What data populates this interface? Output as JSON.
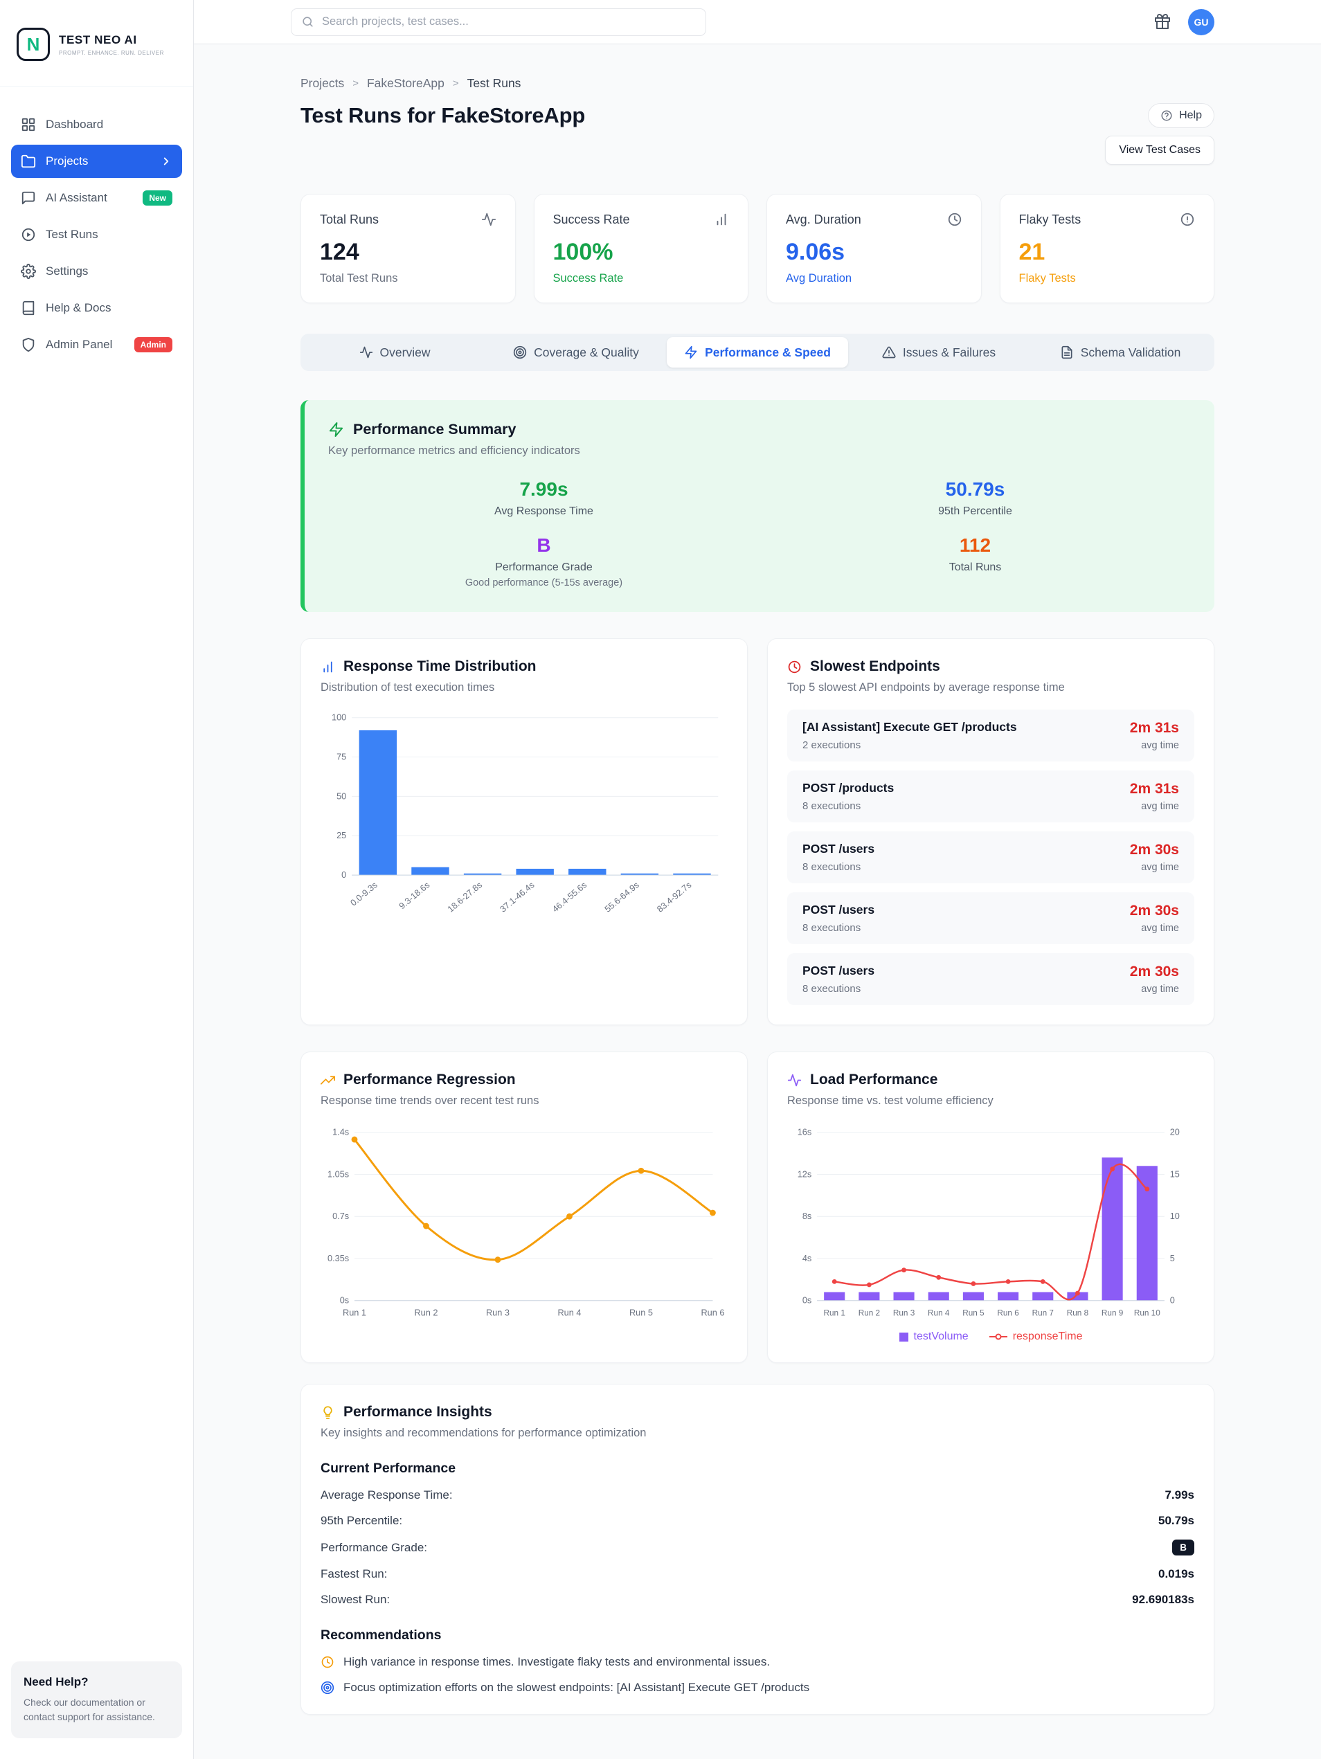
{
  "colors": {
    "accent": "#2563eb",
    "success_green": "#16a34a",
    "info_blue": "#2563eb",
    "grade_purple": "#9333ea",
    "warn_orange": "#ea580c",
    "flaky_amber": "#f59e0b",
    "slow_red": "#dc2626",
    "bar_blue": "#3b82f6",
    "volume_violet": "#8b5cf6"
  },
  "sidebar": {
    "logo": {
      "letter": "N",
      "title": "TEST NEO AI",
      "subtitle": "PROMPT. ENHANCE. RUN. DELIVER"
    },
    "items": [
      {
        "label": "Dashboard",
        "icon": "grid-icon"
      },
      {
        "label": "Projects",
        "icon": "folder-icon",
        "active": true
      },
      {
        "label": "AI Assistant",
        "icon": "chat-icon",
        "badge": "New"
      },
      {
        "label": "Test Runs",
        "icon": "play-circle-icon"
      },
      {
        "label": "Settings",
        "icon": "gear-icon"
      },
      {
        "label": "Help & Docs",
        "icon": "book-icon"
      },
      {
        "label": "Admin Panel",
        "icon": "shield-icon",
        "badge": "Admin"
      }
    ],
    "help_card": {
      "title": "Need Help?",
      "text": "Check our documentation or contact support for assistance."
    }
  },
  "topbar": {
    "search_placeholder": "Search projects, test cases...",
    "avatar_initials": "GU"
  },
  "breadcrumb": {
    "items": [
      "Projects",
      "FakeStoreApp",
      "Test Runs"
    ],
    "separator": ">"
  },
  "page": {
    "title": "Test Runs for FakeStoreApp",
    "help_button": "Help",
    "view_test_cases_button": "View Test Cases"
  },
  "stats": [
    {
      "label": "Total Runs",
      "value": "124",
      "sub": "Total Test Runs",
      "icon": "activity-icon",
      "value_color": "#111827",
      "sub_color": "#6b7280"
    },
    {
      "label": "Success Rate",
      "value": "100%",
      "sub": "Success Rate",
      "icon": "bar-chart-icon",
      "value_color": "#16a34a",
      "sub_color": "#16a34a"
    },
    {
      "label": "Avg. Duration",
      "value": "9.06s",
      "sub": "Avg Duration",
      "icon": "clock-icon",
      "value_color": "#2563eb",
      "sub_color": "#2563eb"
    },
    {
      "label": "Flaky Tests",
      "value": "21",
      "sub": "Flaky Tests",
      "icon": "alert-circle-icon",
      "value_color": "#f59e0b",
      "sub_color": "#f59e0b"
    }
  ],
  "tabs": [
    {
      "label": "Overview",
      "icon": "pulse-icon",
      "active": false
    },
    {
      "label": "Coverage & Quality",
      "icon": "target-icon",
      "active": false
    },
    {
      "label": "Performance & Speed",
      "icon": "zap-icon",
      "active": true
    },
    {
      "label": "Issues & Failures",
      "icon": "warning-icon",
      "active": false
    },
    {
      "label": "Schema Validation",
      "icon": "document-icon",
      "active": false
    }
  ],
  "summary": {
    "title": "Performance Summary",
    "subtitle": "Key performance metrics and efficiency indicators",
    "metrics": [
      {
        "value": "7.99s",
        "label": "Avg Response Time",
        "color": "#16a34a"
      },
      {
        "value": "50.79s",
        "label": "95th Percentile",
        "color": "#2563eb"
      },
      {
        "value": "B",
        "label": "Performance Grade",
        "note": "Good performance (5-15s average)",
        "color": "#9333ea"
      },
      {
        "value": "112",
        "label": "Total Runs",
        "color": "#ea580c"
      }
    ]
  },
  "charts": {
    "distribution": {
      "title": "Response Time Distribution",
      "subtitle": "Distribution of test execution times",
      "icon": "bar-chart-icon",
      "chart": {
        "type": "bar",
        "categories": [
          "0.0-9.3s",
          "9.3-18.6s",
          "18.6-27.8s",
          "37.1-46.4s",
          "46.4-55.6s",
          "55.6-64.9s",
          "83.4-92.7s"
        ],
        "values": [
          92,
          5,
          1,
          4,
          4,
          1,
          1
        ],
        "ylim": [
          0,
          100
        ],
        "yticks": [
          0,
          25,
          50,
          75,
          100
        ],
        "bar_color": "#3b82f6"
      }
    },
    "regression": {
      "title": "Performance Regression",
      "subtitle": "Response time trends over recent test runs",
      "icon": "trend-up-icon",
      "chart": {
        "type": "line",
        "categories": [
          "Run 1",
          "Run 2",
          "Run 3",
          "Run 4",
          "Run 5",
          "Run 6"
        ],
        "values": [
          1.34,
          0.62,
          0.34,
          0.7,
          1.08,
          0.73
        ],
        "ylim": [
          0,
          1.4
        ],
        "yticks": [
          0,
          0.35,
          0.7,
          1.05,
          1.4
        ],
        "ytick_labels": [
          "0s",
          "0.35s",
          "0.7s",
          "1.05s",
          "1.4s"
        ],
        "line_color": "#f59e0b"
      }
    },
    "load": {
      "title": "Load Performance",
      "subtitle": "Response time vs. test volume efficiency",
      "icon": "activity-icon",
      "chart": {
        "type": "combo",
        "categories": [
          "Run 1",
          "Run 2",
          "Run 3",
          "Run 4",
          "Run 5",
          "Run 6",
          "Run 7",
          "Run 8",
          "Run 9",
          "Run 10"
        ],
        "series": [
          {
            "name": "testVolume",
            "type": "bar",
            "axis": "right",
            "color": "#8b5cf6",
            "values": [
              1,
              1,
              1,
              1,
              1,
              1,
              1,
              1,
              17,
              16
            ]
          },
          {
            "name": "responseTime",
            "type": "line",
            "axis": "left",
            "color": "#ef4444",
            "values": [
              1.8,
              1.5,
              2.9,
              2.2,
              1.6,
              1.8,
              1.8,
              0.7,
              12.5,
              10.6
            ]
          }
        ],
        "left_ylim": [
          0,
          16
        ],
        "left_ytick_labels": [
          "0s",
          "4s",
          "8s",
          "12s",
          "16s"
        ],
        "right_ylim": [
          0,
          20
        ],
        "right_ytick_labels": [
          "0",
          "5",
          "10",
          "15",
          "20"
        ]
      }
    }
  },
  "slowest": {
    "title": "Slowest Endpoints",
    "subtitle": "Top 5 slowest API endpoints by average response time",
    "icon": "clock-icon",
    "rows": [
      {
        "endpoint": "[AI Assistant] Execute GET /products",
        "executions": "2 executions",
        "time": "2m 31s",
        "time_sub": "avg time"
      },
      {
        "endpoint": "POST /products",
        "executions": "8 executions",
        "time": "2m 31s",
        "time_sub": "avg time"
      },
      {
        "endpoint": "POST /users",
        "executions": "8 executions",
        "time": "2m 30s",
        "time_sub": "avg time"
      },
      {
        "endpoint": "POST /users",
        "executions": "8 executions",
        "time": "2m 30s",
        "time_sub": "avg time"
      },
      {
        "endpoint": "POST /users",
        "executions": "8 executions",
        "time": "2m 30s",
        "time_sub": "avg time"
      }
    ]
  },
  "insights": {
    "title": "Performance Insights",
    "subtitle": "Key insights and recommendations for performance optimization",
    "icon": "lightbulb-icon",
    "current_performance": {
      "heading": "Current Performance",
      "rows": [
        {
          "label": "Average Response Time:",
          "value": "7.99s"
        },
        {
          "label": "95th Percentile:",
          "value": "50.79s"
        },
        {
          "label": "Performance Grade:",
          "value": "B",
          "badge": true
        },
        {
          "label": "Fastest Run:",
          "value": "0.019s"
        },
        {
          "label": "Slowest Run:",
          "value": "92.690183s"
        }
      ]
    },
    "recommendations": {
      "heading": "Recommendations",
      "items": [
        {
          "icon": "clock-icon",
          "text": "High variance in response times. Investigate flaky tests and environmental issues."
        },
        {
          "icon": "target-icon",
          "text": "Focus optimization efforts on the slowest endpoints: [AI Assistant] Execute GET /products"
        }
      ]
    }
  }
}
